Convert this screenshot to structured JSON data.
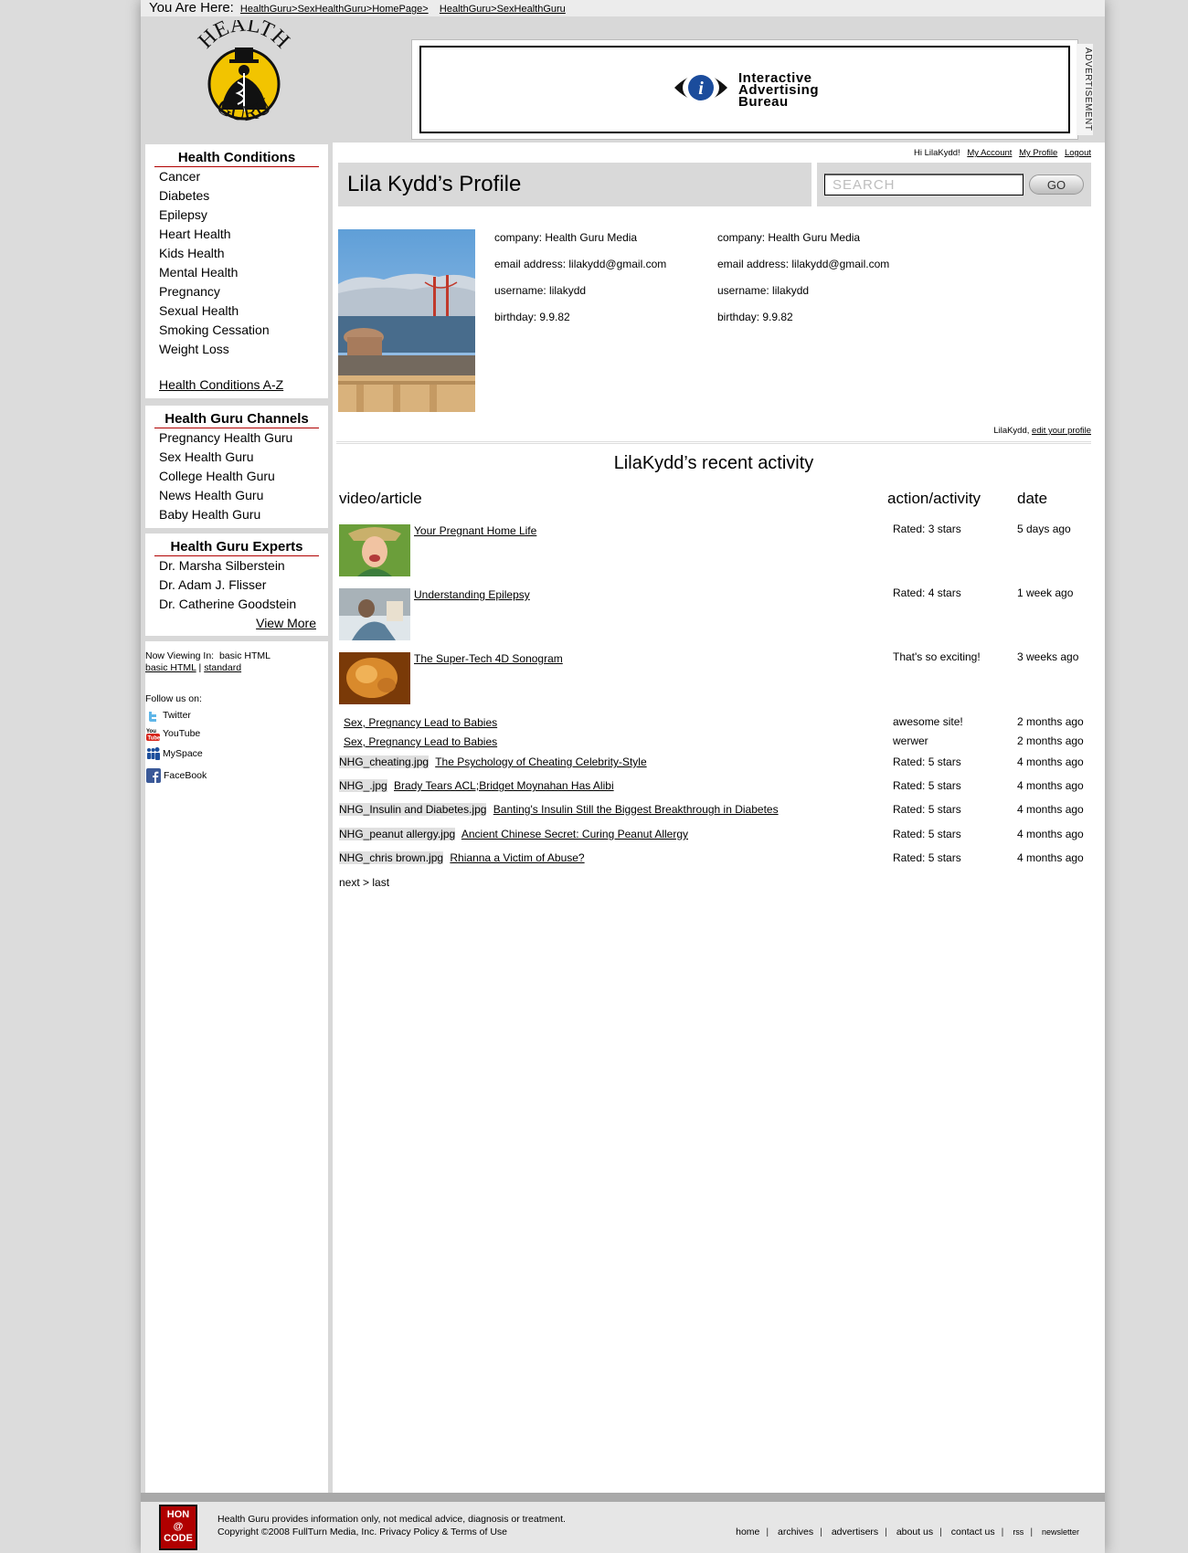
{
  "breadcrumb": {
    "prefix": "You Are Here:",
    "trail1": "HealthGuru>SexHealthGuru>HomePage>",
    "trail2": "HealthGuru>SexHealthGuru"
  },
  "header": {
    "logo_top": "HEALTH",
    "logo_bottom": "GURU",
    "ad_text_line1": "Interactive",
    "ad_text_line2": "Advertising",
    "ad_text_line3": "Bureau",
    "ad_label": "ADVERTISEMENT"
  },
  "sidebar": {
    "conditions_title": "Health Conditions",
    "conditions": [
      "Cancer",
      "Diabetes",
      "Epilepsy",
      "Heart Health",
      "Kids Health",
      "Mental Health",
      "Pregnancy",
      "Sexual Health",
      "Smoking Cessation",
      "Weight Loss"
    ],
    "conditions_az": "Health Conditions A-Z",
    "channels_title": "Health Guru Channels",
    "channels": [
      "Pregnancy Health Guru",
      "Sex Health Guru",
      "College Health Guru",
      "News Health Guru",
      "Baby Health Guru"
    ],
    "experts_title": "Health Guru Experts",
    "experts": [
      "Dr. Marsha Silberstein",
      "Dr. Adam J. Flisser",
      "Dr. Catherine Goodstein"
    ],
    "view_more": "View More",
    "now_viewing_label": "Now Viewing In:",
    "now_viewing_value": "basic HTML",
    "view_basic": "basic HTML",
    "view_sep": "|",
    "view_standard": "standard",
    "follow_label": "Follow us on:",
    "social": [
      "Twitter",
      "YouTube",
      "MySpace",
      "FaceBook"
    ]
  },
  "user_nav": {
    "greeting": "Hi LilaKydd!",
    "my_account": "My Account",
    "my_profile": "My Profile",
    "logout": "Logout"
  },
  "profile": {
    "title": "Lila Kydd’s Profile",
    "search_placeholder": "SEARCH",
    "go_label": "GO",
    "info_left": [
      "company: Health Guru Media",
      "email address: lilakydd@gmail.com",
      "username: lilakydd",
      "birthday: 9.9.82"
    ],
    "info_right": [
      "company: Health Guru Media",
      "email address: lilakydd@gmail.com",
      "username: lilakydd",
      "birthday: 9.9.82"
    ],
    "edit_prefix": "LilaKydd,",
    "edit_link": "edit your profile"
  },
  "activity": {
    "title": "LilaKydd’s recent activity",
    "col_article": "video/article",
    "col_action": "action/activity",
    "col_date": "date",
    "rows": [
      {
        "file": "",
        "title": "Your Pregnant Home Life",
        "action": "Rated: 3 stars",
        "date": "5 days ago"
      },
      {
        "file": "",
        "title": "Understanding Epilepsy",
        "action": "Rated: 4 stars",
        "date": "1 week ago"
      },
      {
        "file": "",
        "title": "The Super-Tech 4D Sonogram",
        "action": "That's so exciting!",
        "date": "3 weeks ago"
      },
      {
        "file": "",
        "title": "Sex, Pregnancy Lead to Babies",
        "action": "awesome site!",
        "date": "2 months ago"
      },
      {
        "file": "",
        "title": "Sex, Pregnancy Lead to Babies",
        "action": "werwer",
        "date": "2 months ago"
      },
      {
        "file": "NHG_cheating.jpg",
        "title": "The Psychology of Cheating Celebrity-Style",
        "action": "Rated: 5 stars",
        "date": "4 months ago"
      },
      {
        "file": "NHG_.jpg",
        "title": "Brady Tears ACL;Bridget Moynahan Has Alibi",
        "action": "Rated: 5 stars",
        "date": "4 months ago"
      },
      {
        "file": "NHG_Insulin and Diabetes.jpg",
        "title": "Banting's Insulin Still the Biggest Breakthrough in Diabetes",
        "action": "Rated: 5 stars",
        "date": "4 months ago"
      },
      {
        "file": "NHG_peanut allergy.jpg",
        "title": "Ancient Chinese Secret: Curing Peanut Allergy",
        "action": "Rated: 5 stars",
        "date": "4 months ago"
      },
      {
        "file": "NHG_chris brown.jpg",
        "title": "Rhianna a Victim of Abuse?",
        "action": "Rated: 5 stars",
        "date": "4 months ago"
      }
    ],
    "pager": "next > last"
  },
  "footer": {
    "badge_line1": "HON",
    "badge_line2": "@",
    "badge_line3": "CODE",
    "line1": "Health Guru provides information only, not medical advice, diagnosis or treatment.",
    "line2": "Copyright ©2008 FullTurn Media, Inc. Privacy Policy & Terms of Use",
    "links": [
      "home",
      "archives",
      "advertisers",
      "about us",
      "contact us",
      "rss",
      "newsletter"
    ]
  },
  "colors": {
    "accent_red": "#b00000",
    "panel_gray": "#d8d8d8",
    "logo_yellow": "#f2c400"
  }
}
